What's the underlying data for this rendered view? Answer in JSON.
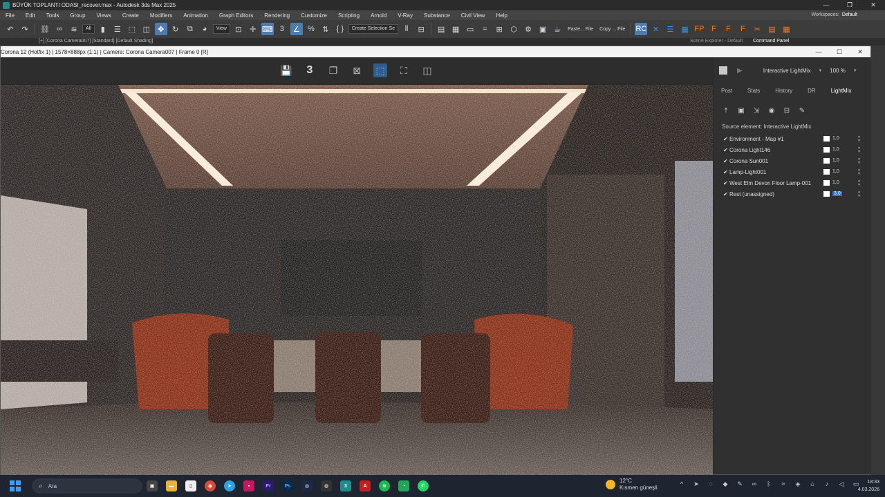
{
  "window": {
    "title": "BÜYÜK TOPLANTI ODASI_recover.max - Autodesk 3ds Max 2025",
    "controls": [
      "—",
      "❐",
      "✕"
    ]
  },
  "menu": {
    "items": [
      "File",
      "Edit",
      "Tools",
      "Group",
      "Views",
      "Create",
      "Modifiers",
      "Animation",
      "Graph Editors",
      "Rendering",
      "Customize",
      "Scripting",
      "Arnold",
      "V-Ray",
      "Substance",
      "Civil View",
      "Help"
    ],
    "workspace_label": "Workspaces:",
    "workspace_value": "Default"
  },
  "toolbar": {
    "filter_dropdown": "All",
    "view_dropdown": "View",
    "selection_set_dropdown": "Create Selection Se",
    "paste_file": "Paste... File",
    "copy_file": "Copy ... File"
  },
  "substrip": {
    "viewport_label": "[+] [Corona Camera007] [Standard] [Default Shading]",
    "scene_explorer": "Scene Explorer - Default",
    "command_panel": "Command Panel"
  },
  "vfb": {
    "title": "Corona 12 (Hotfix 1) | 1578×888px (1:1) | Camera: Corona Camera007 | Frame 0 [R]",
    "controls": [
      "—",
      "☐",
      "✕"
    ],
    "toolbar_number": "3"
  },
  "panel": {
    "mode": "Interactive LightMix",
    "zoom": "100 %",
    "tabs": [
      "Post",
      "Stats",
      "History",
      "DR",
      "LightMix"
    ],
    "active_tab": "LightMix",
    "source_element": "Source element: Interactive LightMix",
    "lights": [
      {
        "name": "Environment - Map #1",
        "value": "1,0"
      },
      {
        "name": "Corona Light146",
        "value": "1,0"
      },
      {
        "name": "Corona Sun001",
        "value": "1,0"
      },
      {
        "name": "Lamp-Light001",
        "value": "1,0"
      },
      {
        "name": "West Elm Devon Floor Lamp-001",
        "value": "1,0"
      },
      {
        "name": "Rest (unassigned)",
        "value": "3,0"
      }
    ]
  },
  "taskbar": {
    "search_placeholder": "Ara",
    "weather_temp": "12°C",
    "weather_desc": "Kısmen güneşli",
    "time": "18:33",
    "date": "4.03.2026"
  },
  "colors": {
    "accent": "#4f7cb0",
    "selected_blue": "#2f6fd0",
    "corona_orange": "#f07c2a"
  }
}
